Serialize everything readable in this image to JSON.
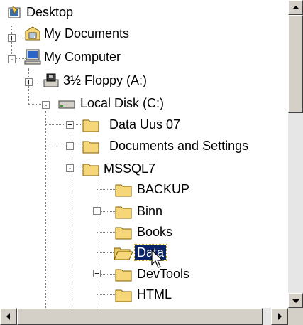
{
  "tree": {
    "items": [
      {
        "label": "Desktop",
        "icon": "desktop-icon"
      },
      {
        "label": "My Documents",
        "icon": "my-documents-icon",
        "expander": "+"
      },
      {
        "label": "My Computer",
        "icon": "my-computer-icon",
        "expander": "-"
      },
      {
        "label": "3½ Floppy (A:)",
        "icon": "floppy-drive-icon",
        "expander": "+"
      },
      {
        "label": "Local Disk (C:)",
        "icon": "hard-disk-icon",
        "expander": "-"
      },
      {
        "label": "Data Uus 07",
        "icon": "folder-icon",
        "expander": "+"
      },
      {
        "label": "Documents and Settings",
        "icon": "folder-icon",
        "expander": "+"
      },
      {
        "label": "MSSQL7",
        "icon": "folder-icon",
        "expander": "-"
      },
      {
        "label": "BACKUP",
        "icon": "folder-icon"
      },
      {
        "label": "Binn",
        "icon": "folder-icon",
        "expander": "+"
      },
      {
        "label": "Books",
        "icon": "folder-icon"
      },
      {
        "label": "Data",
        "icon": "open-folder-icon",
        "selected": true
      },
      {
        "label": "DevTools",
        "icon": "folder-icon",
        "expander": "+"
      },
      {
        "label": "HTML",
        "icon": "folder-icon"
      }
    ]
  },
  "colors": {
    "selection": "#0a246a",
    "folder": "#f5d77a",
    "scrollbar": "#d4d0c8"
  }
}
